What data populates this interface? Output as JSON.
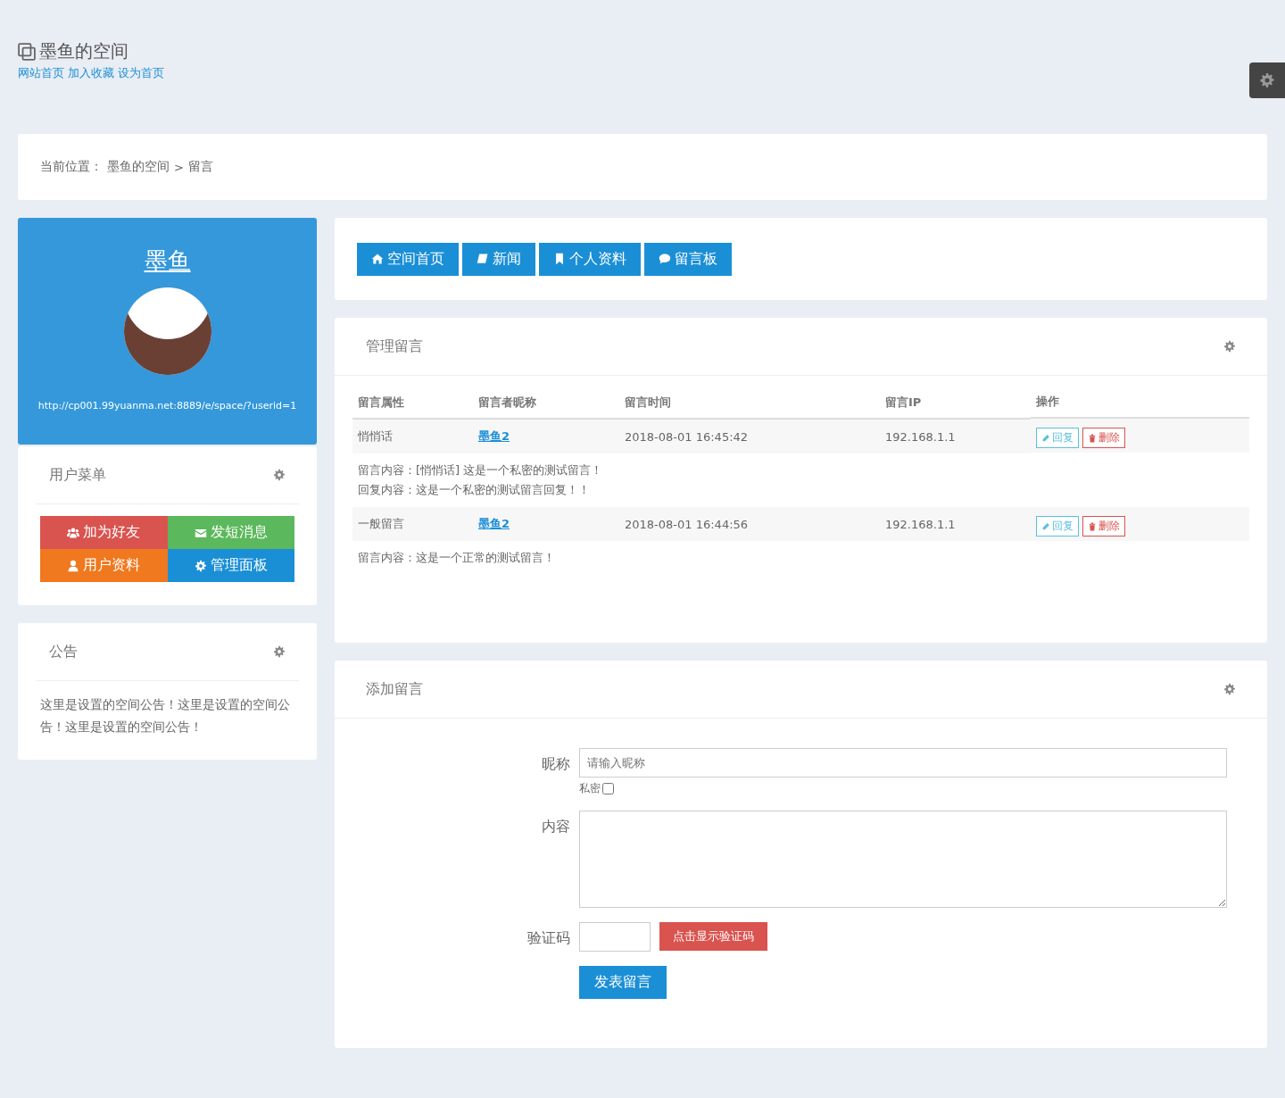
{
  "header": {
    "title": "墨鱼的空间",
    "links": [
      "网站首页",
      "加入收藏",
      "设为首页"
    ]
  },
  "breadcrumb": {
    "label": "当前位置：",
    "path": [
      "墨鱼的空间",
      "留言"
    ],
    "separator": ">"
  },
  "profile": {
    "name": "墨鱼",
    "url": "http://cp001.99yuanma.net:8889/e/space/?userid=1"
  },
  "user_menu": {
    "title": "用户菜单",
    "buttons": [
      {
        "label": "加为好友",
        "color": "#d9534f"
      },
      {
        "label": "发短消息",
        "color": "#5cb85c"
      },
      {
        "label": "用户资料",
        "color": "#f0781e"
      },
      {
        "label": "管理面板",
        "color": "#1b8fd6"
      }
    ]
  },
  "notice": {
    "title": "公告",
    "text": "这里是设置的空间公告！这里是设置的空间公告！这里是设置的空间公告！"
  },
  "nav_tabs": [
    {
      "label": "空间首页"
    },
    {
      "label": "新闻"
    },
    {
      "label": "个人资料"
    },
    {
      "label": "留言板"
    }
  ],
  "manage": {
    "title": "管理留言",
    "columns": [
      "留言属性",
      "留言者昵称",
      "留言时间",
      "留言IP",
      "操作"
    ],
    "rows": [
      {
        "type": "悄悄话",
        "nickname": "墨鱼2",
        "time": "2018-08-01 16:45:42",
        "ip": "192.168.1.1",
        "reply": "回复",
        "delete": "删除",
        "lines": [
          "留言内容：[悄悄话] 这是一个私密的测试留言！",
          "回复内容：这是一个私密的测试留言回复！！"
        ]
      },
      {
        "type": "一般留言",
        "nickname": "墨鱼2",
        "time": "2018-08-01 16:44:56",
        "ip": "192.168.1.1",
        "reply": "回复",
        "delete": "删除",
        "lines": [
          "留言内容：这是一个正常的测试留言！"
        ]
      }
    ]
  },
  "add": {
    "title": "添加留言",
    "nickname_label": "昵称",
    "nickname_placeholder": "请输入昵称",
    "private_label": "私密",
    "private_checked": false,
    "content_label": "内容",
    "captcha_label": "验证码",
    "captcha_button": "点击显示验证码",
    "submit": "发表留言"
  }
}
